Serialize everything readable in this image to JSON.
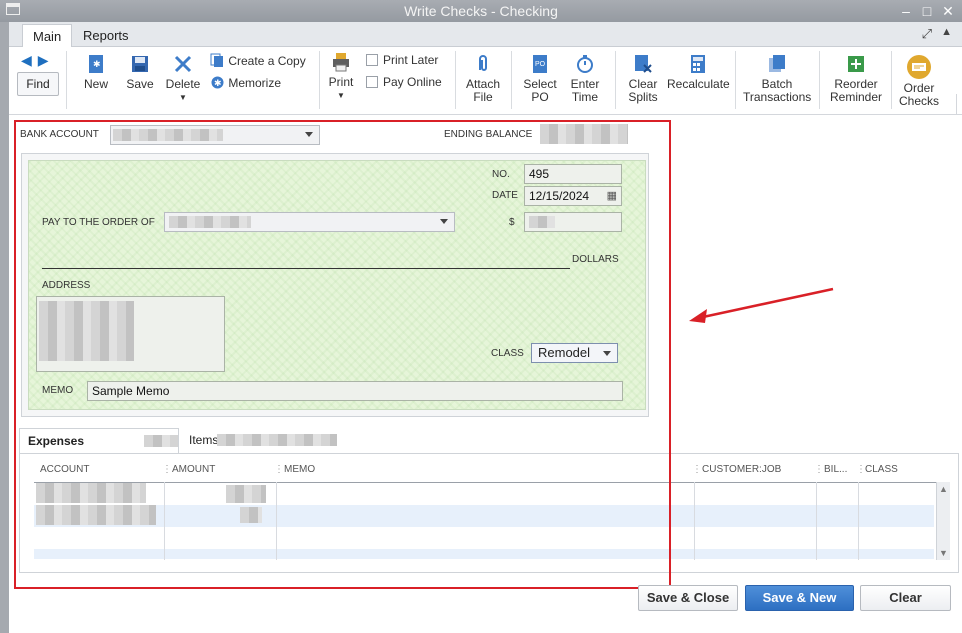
{
  "window": {
    "title": "Write Checks - Checking",
    "minimize": "–",
    "maximize": "□",
    "close": "✕"
  },
  "tabs": [
    "Main",
    "Reports"
  ],
  "toolbar": {
    "find": "Find",
    "new": "New",
    "save": "Save",
    "delete": "Delete",
    "create_copy": "Create a Copy",
    "memorize": "Memorize",
    "print": "Print",
    "print_later": "Print Later",
    "pay_online": "Pay Online",
    "attach_file_1": "Attach",
    "attach_file_2": "File",
    "select_po_1": "Select",
    "select_po_2": "PO",
    "enter_time_1": "Enter",
    "enter_time_2": "Time",
    "clear_splits_1": "Clear",
    "clear_splits_2": "Splits",
    "recalculate": "Recalculate",
    "batch_1": "Batch",
    "batch_2": "Transactions",
    "reorder_1": "Reorder",
    "reorder_2": "Reminder",
    "order_checks_1": "Order",
    "order_checks_2": "Checks"
  },
  "form": {
    "bank_account_label": "BANK ACCOUNT",
    "ending_balance_label": "ENDING BALANCE",
    "no_label": "NO.",
    "no_value": "495",
    "date_label": "DATE",
    "date_value": "12/15/2024",
    "pay_to_label": "PAY TO THE ORDER OF",
    "dollar_sign": "$",
    "dollars_label": "DOLLARS",
    "address_label": "ADDRESS",
    "class_label": "CLASS",
    "class_value": "Remodel",
    "memo_label": "MEMO",
    "memo_value": "Sample Memo"
  },
  "detail_tabs": {
    "expenses": "Expenses",
    "items": "Items"
  },
  "grid": {
    "headers": [
      "ACCOUNT",
      "AMOUNT",
      "MEMO",
      "CUSTOMER:JOB",
      "BIL...",
      "CLASS"
    ]
  },
  "buttons": {
    "save_close": "Save & Close",
    "save_new": "Save & New",
    "clear": "Clear"
  },
  "colors": {
    "annotation": "#d92027",
    "check_bg": "#e6f5d9",
    "primary_button": "#2d6fc2"
  }
}
